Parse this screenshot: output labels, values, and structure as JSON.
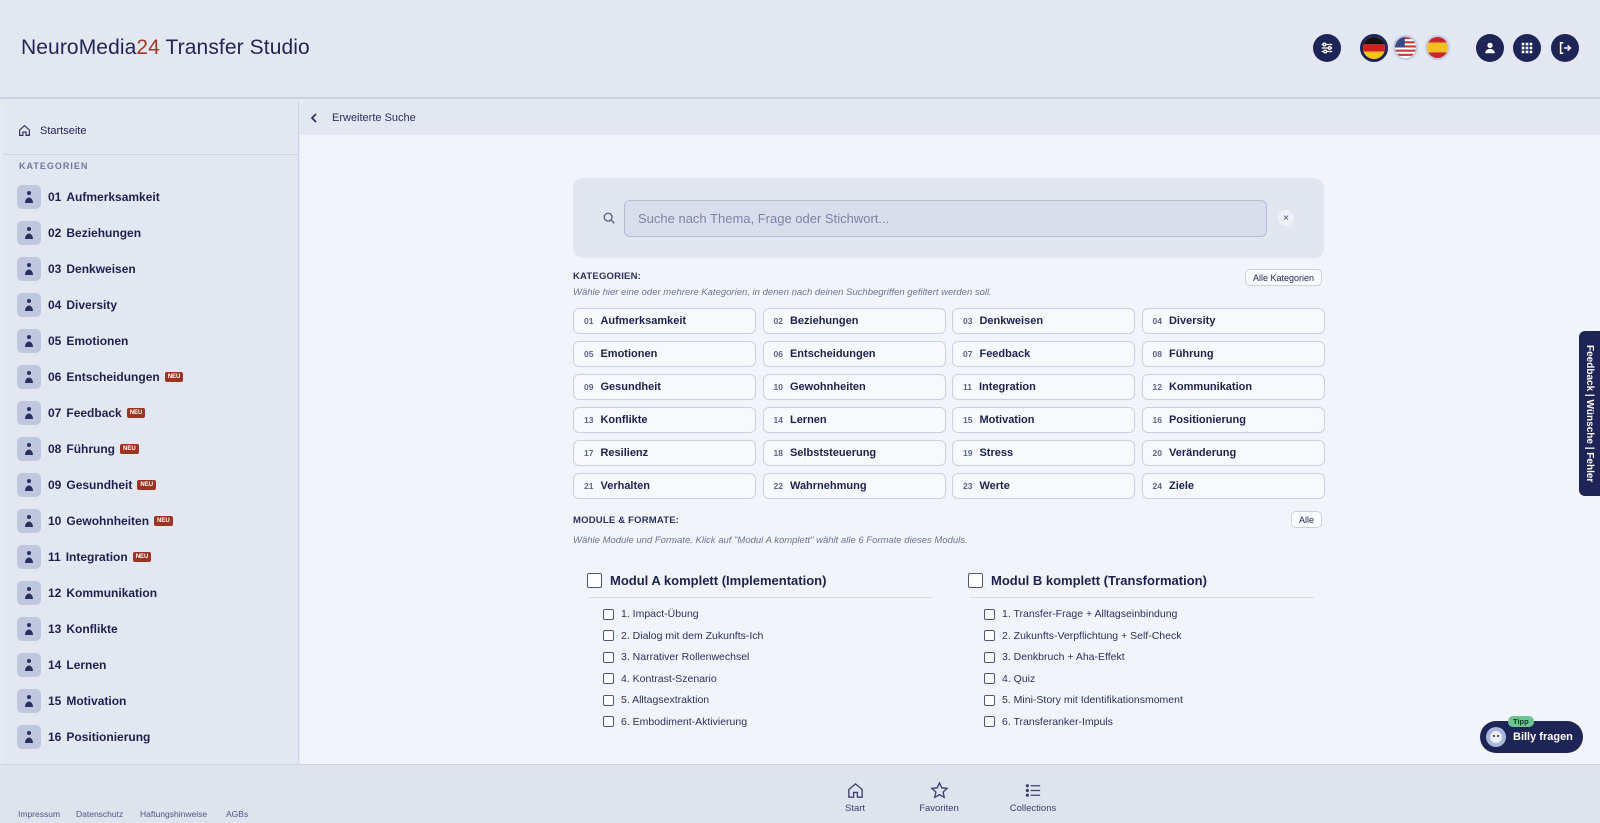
{
  "app": {
    "title_prefix": "NeuroMedia",
    "title_number": "24",
    "title_suffix": " Transfer Studio"
  },
  "header": {
    "filter_icon": "sliders-icon",
    "flags": [
      "de-flag",
      "us-flag",
      "es-flag"
    ],
    "active_flag": "de-flag",
    "right_icons": [
      "user-icon",
      "grid-icon",
      "logout-icon"
    ]
  },
  "sidebar": {
    "home_label": "Startseite",
    "section_label": "KATEGORIEN",
    "badge": "NEU",
    "items": [
      {
        "num": "01",
        "label": "Aufmerksamkeit",
        "neu": false
      },
      {
        "num": "02",
        "label": "Beziehungen",
        "neu": false
      },
      {
        "num": "03",
        "label": "Denkweisen",
        "neu": false
      },
      {
        "num": "04",
        "label": "Diversity",
        "neu": false
      },
      {
        "num": "05",
        "label": "Emotionen",
        "neu": false
      },
      {
        "num": "06",
        "label": "Entscheidungen",
        "neu": true
      },
      {
        "num": "07",
        "label": "Feedback",
        "neu": true
      },
      {
        "num": "08",
        "label": "Führung",
        "neu": true
      },
      {
        "num": "09",
        "label": "Gesundheit",
        "neu": true
      },
      {
        "num": "10",
        "label": "Gewohnheiten",
        "neu": true
      },
      {
        "num": "11",
        "label": "Integration",
        "neu": true
      },
      {
        "num": "12",
        "label": "Kommunikation",
        "neu": false
      },
      {
        "num": "13",
        "label": "Konflikte",
        "neu": false
      },
      {
        "num": "14",
        "label": "Lernen",
        "neu": false
      },
      {
        "num": "15",
        "label": "Motivation",
        "neu": false
      },
      {
        "num": "16",
        "label": "Positionierung",
        "neu": false
      }
    ]
  },
  "breadcrumb": {
    "label": "Erweiterte Suche"
  },
  "search": {
    "placeholder": "Suche nach Thema, Frage oder Stichwort...",
    "value": "",
    "clear": "×"
  },
  "categories": {
    "title": "KATEGORIEN:",
    "description": "Wähle hier eine oder mehrere Kategorien, in denen nach deinen Suchbegriffen gefiltert werden soll.",
    "all_button": "Alle Kategorien",
    "items": [
      {
        "num": "01",
        "label": "Aufmerksamkeit"
      },
      {
        "num": "02",
        "label": "Beziehungen"
      },
      {
        "num": "03",
        "label": "Denkweisen"
      },
      {
        "num": "04",
        "label": "Diversity"
      },
      {
        "num": "05",
        "label": "Emotionen"
      },
      {
        "num": "06",
        "label": "Entscheidungen"
      },
      {
        "num": "07",
        "label": "Feedback"
      },
      {
        "num": "08",
        "label": "Führung"
      },
      {
        "num": "09",
        "label": "Gesundheit"
      },
      {
        "num": "10",
        "label": "Gewohnheiten"
      },
      {
        "num": "11",
        "label": "Integration"
      },
      {
        "num": "12",
        "label": "Kommunikation"
      },
      {
        "num": "13",
        "label": "Konflikte"
      },
      {
        "num": "14",
        "label": "Lernen"
      },
      {
        "num": "15",
        "label": "Motivation"
      },
      {
        "num": "16",
        "label": "Positionierung"
      },
      {
        "num": "17",
        "label": "Resilienz"
      },
      {
        "num": "18",
        "label": "Selbststeuerung"
      },
      {
        "num": "19",
        "label": "Stress"
      },
      {
        "num": "20",
        "label": "Veränderung"
      },
      {
        "num": "21",
        "label": "Verhalten"
      },
      {
        "num": "22",
        "label": "Wahrnehmung"
      },
      {
        "num": "23",
        "label": "Werte"
      },
      {
        "num": "24",
        "label": "Ziele"
      }
    ]
  },
  "modules": {
    "title": "MODULE & FORMATE:",
    "description": "Wähle Module und Formate. Klick auf \"Modul A komplett\" wählt alle 6 Formate dieses Moduls.",
    "all_button": "Alle",
    "groups": [
      {
        "title": "Modul A komplett (Implementation)",
        "items": [
          "1. Impact-Übung",
          "2. Dialog mit dem Zukunfts-Ich",
          "3. Narrativer Rollenwechsel",
          "4. Kontrast-Szenario",
          "5. Alltagsextraktion",
          "6. Embodiment-Aktivierung"
        ]
      },
      {
        "title": "Modul B komplett (Transformation)",
        "items": [
          "1. Transfer-Frage + Alltagseinbindung",
          "2. Zukunfts-Verpflichtung + Self-Check",
          "3. Denkbruch + Aha-Effekt",
          "4. Quiz",
          "5. Mini-Story mit Identifikationsmoment",
          "6. Transferanker-Impuls"
        ]
      }
    ]
  },
  "footer": {
    "links": [
      "Impressum",
      "Datenschutz",
      "Haftungshinweise",
      "AGBs"
    ],
    "nav": [
      {
        "label": "Start",
        "icon": "home-icon"
      },
      {
        "label": "Favoriten",
        "icon": "star-icon"
      },
      {
        "label": "Collections",
        "icon": "list-icon"
      }
    ]
  },
  "feedback_tab": {
    "label": "Feedback | Wünsche | Fehler"
  },
  "assistant": {
    "label": "Billy fragen",
    "badge": "Tipp"
  },
  "colors": {
    "primary": "#1e2456",
    "accent": "#a23a22",
    "badge": "#9b3420",
    "tipp": "#6cc48f"
  }
}
